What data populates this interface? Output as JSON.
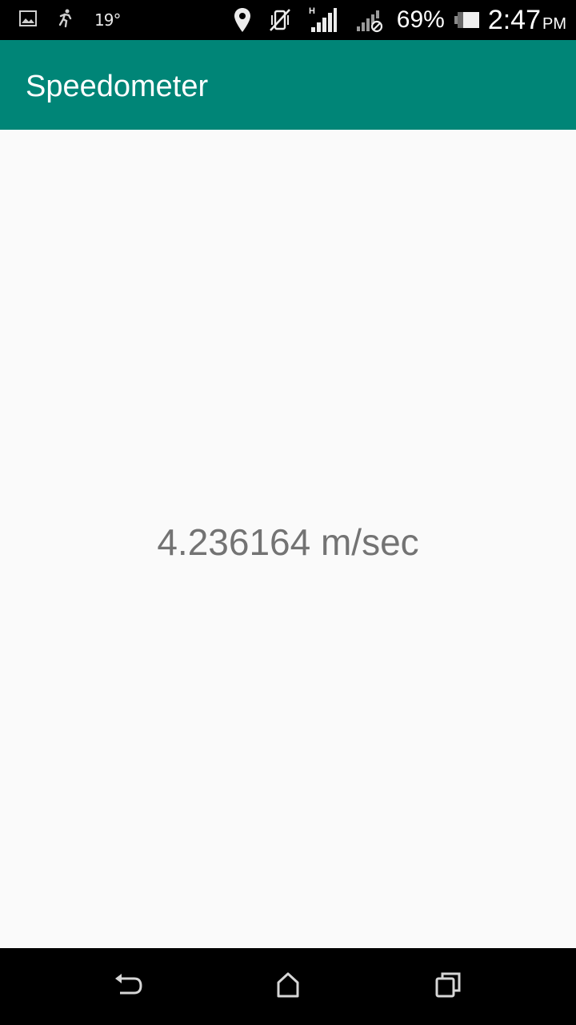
{
  "status_bar": {
    "temperature": "19°",
    "battery_percent": "69%",
    "time": "2:47",
    "am_pm": "PM",
    "network_type": "H"
  },
  "app_bar": {
    "title": "Speedometer",
    "color": "#008577"
  },
  "main": {
    "speed_value": "4.236164 m/sec"
  },
  "nav_bar": {
    "icons": [
      "back-icon",
      "home-icon",
      "recents-icon"
    ]
  }
}
